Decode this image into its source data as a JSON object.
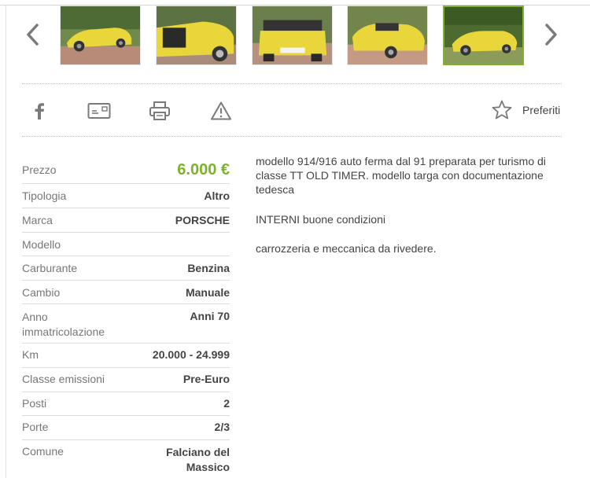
{
  "gallery": {
    "prev_icon": "chevron-left-icon",
    "next_icon": "chevron-right-icon",
    "thumbnails": [
      {
        "name": "photo-1",
        "selected": false
      },
      {
        "name": "photo-2",
        "selected": false
      },
      {
        "name": "photo-3",
        "selected": false
      },
      {
        "name": "photo-4",
        "selected": false
      },
      {
        "name": "photo-5",
        "selected": true
      }
    ]
  },
  "toolbar": {
    "icons": [
      "facebook-icon",
      "email-icon",
      "print-icon",
      "report-warning-icon"
    ],
    "favorites_label": "Preferiti",
    "favorites_icon": "star-icon"
  },
  "specs": {
    "price_label": "Prezzo",
    "price_value": "6.000 €",
    "rows": [
      {
        "label": "Tipologia",
        "value": "Altro"
      },
      {
        "label": "Marca",
        "value": "PORSCHE"
      },
      {
        "label": "Modello",
        "value": ""
      },
      {
        "label": "Carburante",
        "value": "Benzina"
      },
      {
        "label": "Cambio",
        "value": "Manuale"
      },
      {
        "label": "Anno immatricolazione",
        "value": "Anni 70"
      },
      {
        "label": "Km",
        "value": "20.000 - 24.999"
      },
      {
        "label": "Classe emissioni",
        "value": "Pre-Euro"
      },
      {
        "label": "Posti",
        "value": "2"
      },
      {
        "label": "Porte",
        "value": "2/3"
      },
      {
        "label": "Comune",
        "value": "Falciano del Massico"
      }
    ]
  },
  "description": {
    "paragraphs": [
      "modello 914/916 auto ferma dal 91 preparata per turismo di classe TT OLD TIMER. modello targa con documentazione tedesca",
      "INTERNI buone condizioni",
      "carrozzeria e meccanica da rivedere."
    ]
  },
  "colors": {
    "accent": "#7cb32a",
    "car_yellow": "#e8d63a"
  }
}
